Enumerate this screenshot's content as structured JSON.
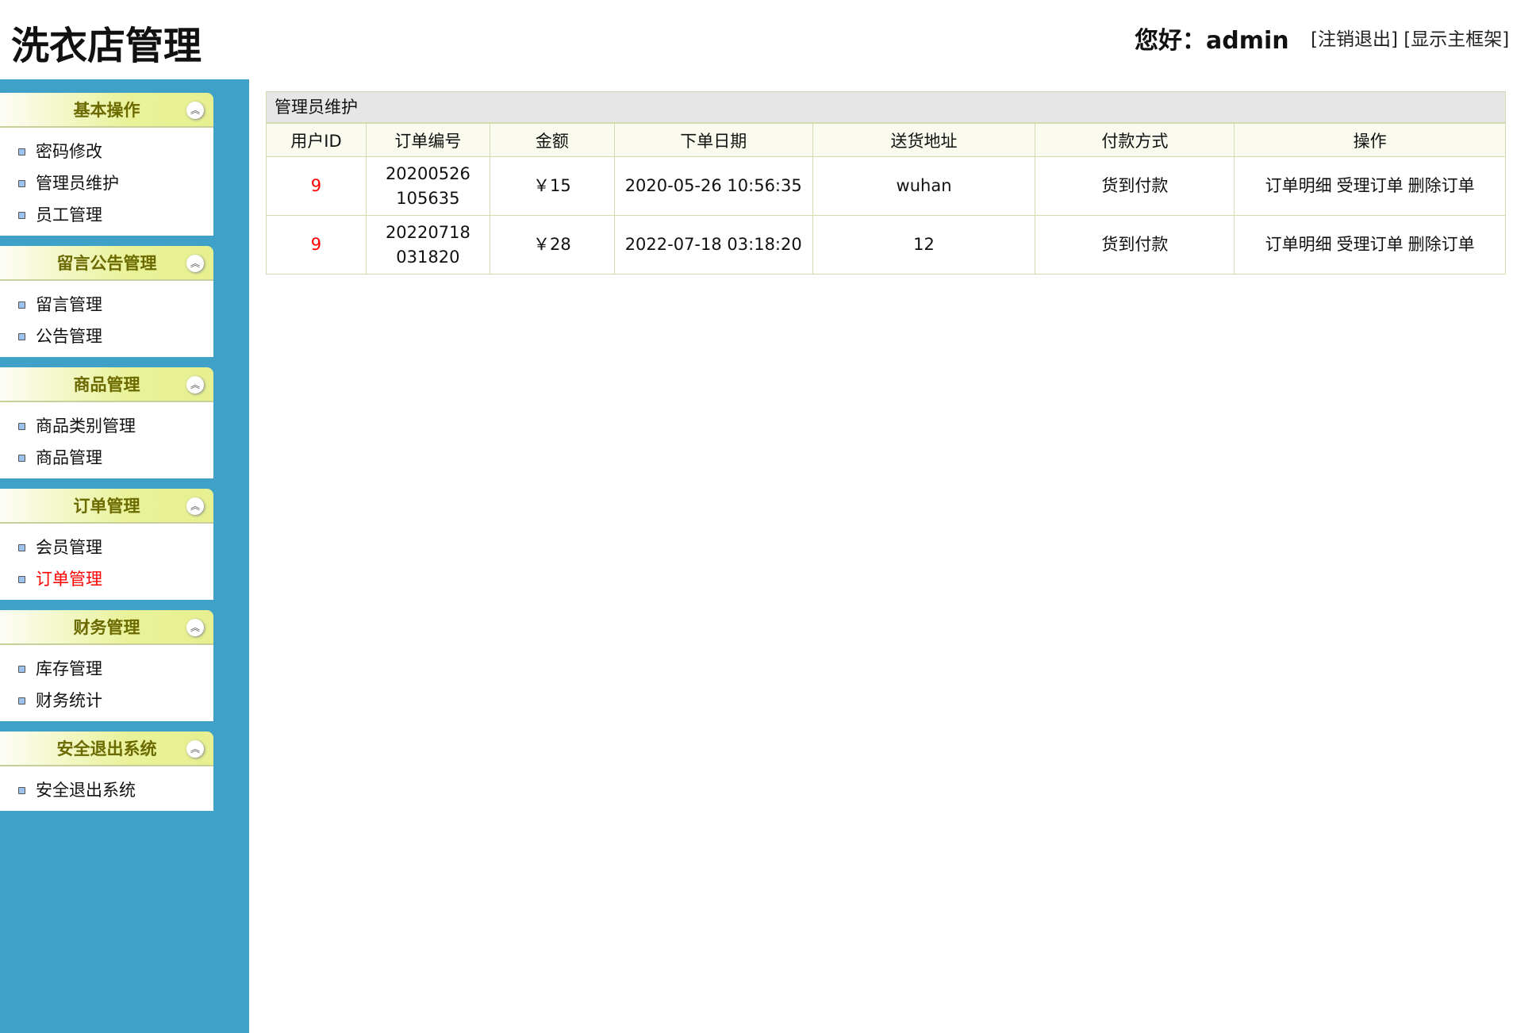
{
  "header": {
    "title": "洗衣店管理",
    "greeting": "您好：admin",
    "logout": "[注销退出]",
    "show_frame": "[显示主框架]"
  },
  "sidebar": {
    "sections": [
      {
        "title": "基本操作",
        "items": [
          "密码修改",
          "管理员维护",
          "员工管理"
        ]
      },
      {
        "title": "留言公告管理",
        "items": [
          "留言管理",
          "公告管理"
        ]
      },
      {
        "title": "商品管理",
        "items": [
          "商品类别管理",
          "商品管理"
        ]
      },
      {
        "title": "订单管理",
        "items": [
          "会员管理",
          "订单管理"
        ]
      },
      {
        "title": "财务管理",
        "items": [
          "库存管理",
          "财务统计"
        ]
      },
      {
        "title": "安全退出系统",
        "items": [
          "安全退出系统"
        ]
      }
    ],
    "active": "订单管理",
    "toggle_icon": "double-chevron-up-icon"
  },
  "table": {
    "caption": "管理员维护",
    "columns": [
      "用户ID",
      "订单编号",
      "金额",
      "下单日期",
      "送货地址",
      "付款方式",
      "操作"
    ],
    "rows": [
      {
        "uid": "9",
        "order_no": "20200526105635",
        "amount": "￥15",
        "date": "2020-05-26 10:56:35",
        "address": "wuhan",
        "payment": "货到付款"
      },
      {
        "uid": "9",
        "order_no": "20220718031820",
        "amount": "￥28",
        "date": "2022-07-18 03:18:20",
        "address": "12",
        "payment": "货到付款"
      }
    ],
    "actions": [
      "订单明细",
      "受理订单",
      "删除订单"
    ]
  }
}
